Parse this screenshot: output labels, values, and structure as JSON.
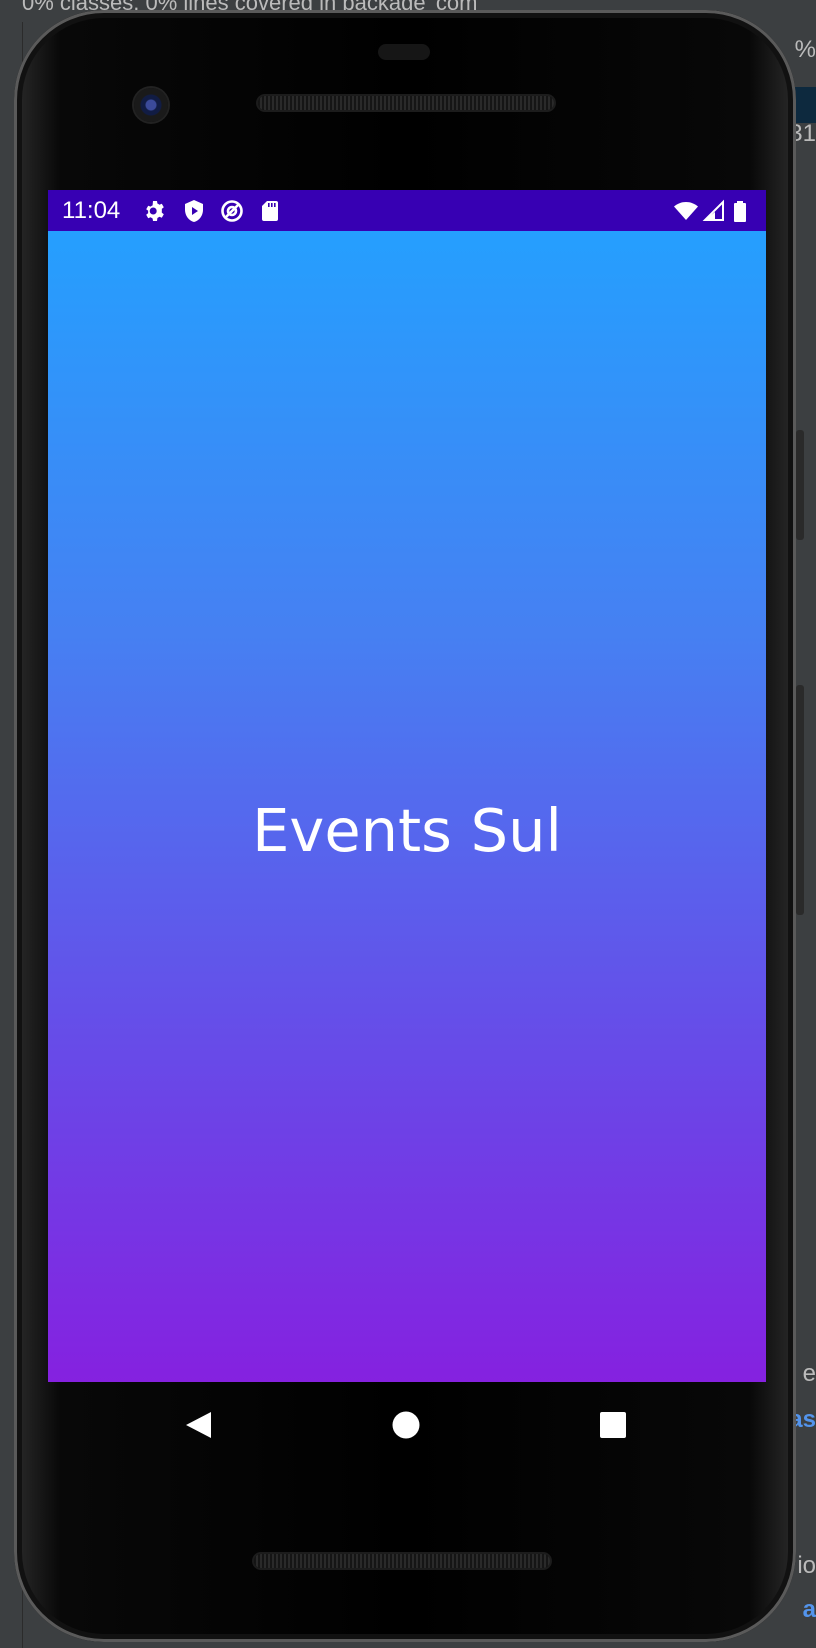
{
  "ide": {
    "top_text": "0% classes, 0% lines covered in package 'com",
    "right_fragments": [
      "%",
      "31",
      "e",
      "as",
      "io",
      "a"
    ]
  },
  "status_bar": {
    "time": "11:04",
    "left_icons": [
      "settings-icon",
      "shield-play-icon",
      "at-sign-icon",
      "sd-card-icon"
    ],
    "right_icons": [
      "wifi-icon",
      "cell-signal-icon",
      "battery-icon"
    ],
    "background": "#3700b3"
  },
  "app": {
    "title": "Events Sul",
    "gradient_top": "#259ffe",
    "gradient_bottom": "#8521e0"
  },
  "nav_bar": {
    "buttons": [
      "back-icon",
      "home-icon",
      "recents-icon"
    ]
  }
}
